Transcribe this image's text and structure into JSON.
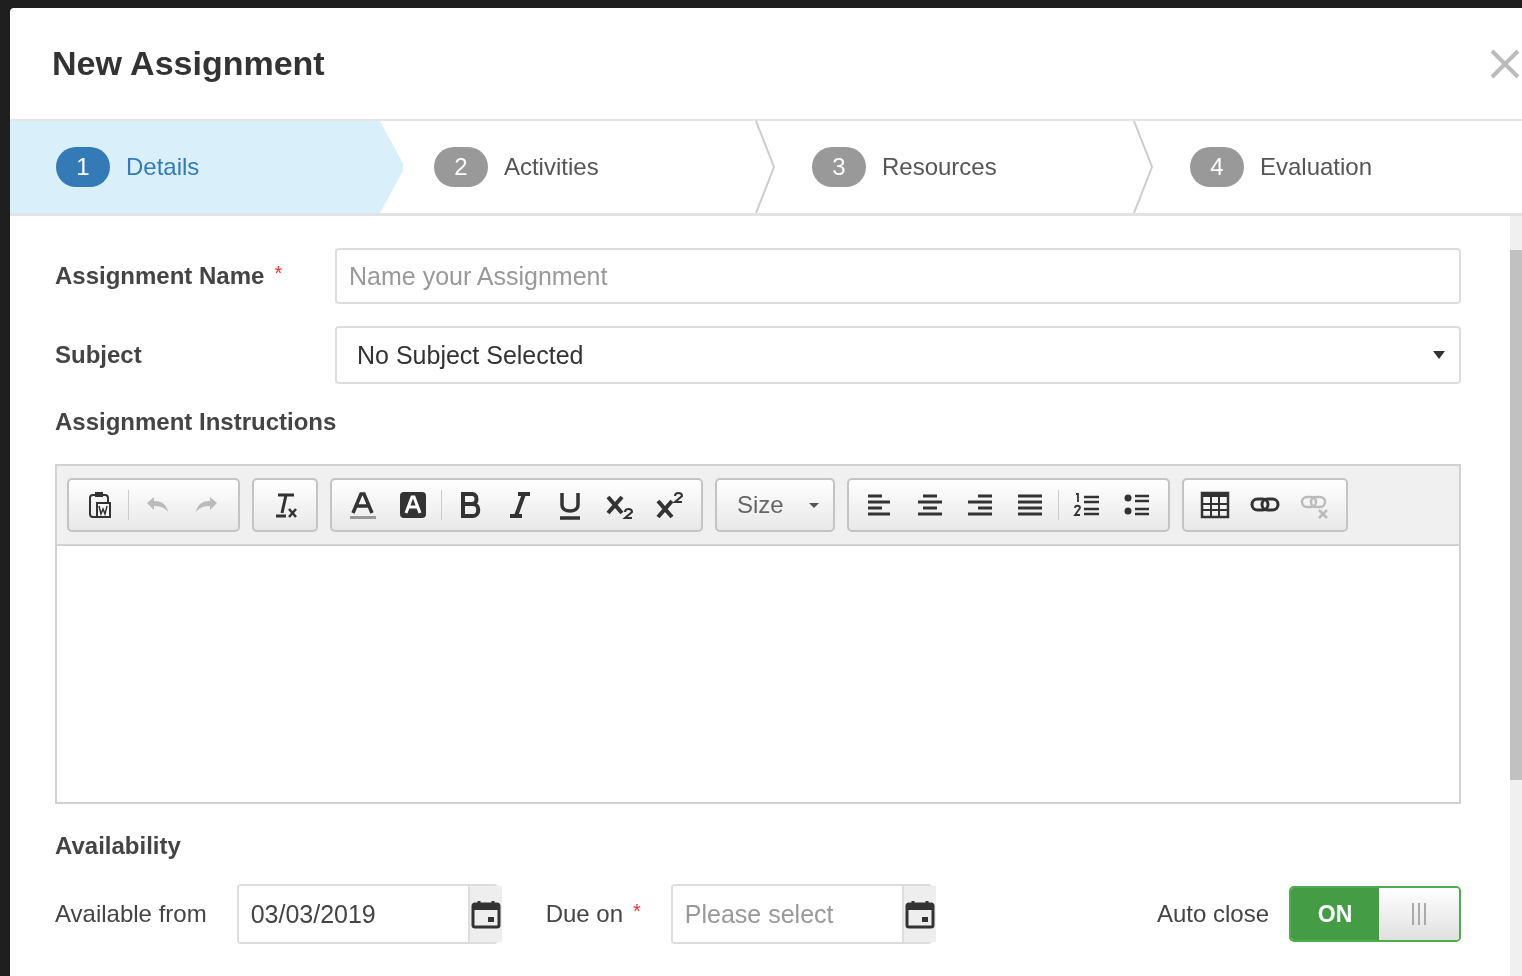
{
  "dialog": {
    "title": "New Assignment"
  },
  "steps": [
    {
      "number": "1",
      "label": "Details",
      "selected": true
    },
    {
      "number": "2",
      "label": "Activities",
      "selected": false
    },
    {
      "number": "3",
      "label": "Resources",
      "selected": false
    },
    {
      "number": "4",
      "label": "Evaluation",
      "selected": false
    }
  ],
  "assignment_name": {
    "label": "Assignment Name",
    "required_mark": "*",
    "placeholder": "Name your Assignment"
  },
  "subject": {
    "label": "Subject",
    "value": "No Subject Selected"
  },
  "instructions": {
    "label": "Assignment Instructions",
    "toolbar": [
      [
        {
          "kind": "paste",
          "disabled": false
        },
        {
          "kind": "sep"
        },
        {
          "kind": "undo",
          "disabled": true
        },
        {
          "kind": "redo",
          "disabled": true
        }
      ],
      [
        {
          "kind": "clear-format",
          "disabled": false
        }
      ],
      [
        {
          "kind": "text-color",
          "disabled": false
        },
        {
          "kind": "bg-color",
          "disabled": false
        },
        {
          "kind": "sep"
        },
        {
          "kind": "bold",
          "disabled": false
        },
        {
          "kind": "italic",
          "disabled": false
        },
        {
          "kind": "underline",
          "disabled": false
        },
        {
          "kind": "subscript",
          "disabled": false
        },
        {
          "kind": "superscript",
          "disabled": false
        }
      ],
      [
        {
          "kind": "size",
          "label": "Size",
          "disabled": false
        }
      ],
      [
        {
          "kind": "align-left",
          "disabled": false
        },
        {
          "kind": "align-center",
          "disabled": false
        },
        {
          "kind": "align-right",
          "disabled": false
        },
        {
          "kind": "justify",
          "disabled": false
        },
        {
          "kind": "sep"
        },
        {
          "kind": "numbered-list",
          "disabled": false
        },
        {
          "kind": "bullet-list",
          "disabled": false
        }
      ],
      [
        {
          "kind": "table",
          "disabled": false
        },
        {
          "kind": "link",
          "disabled": false
        },
        {
          "kind": "unlink",
          "disabled": true
        }
      ]
    ]
  },
  "availability": {
    "label": "Availability",
    "available_from": {
      "label": "Available from",
      "value": "03/03/2019"
    },
    "due_on": {
      "label": "Due on",
      "required_mark": "*",
      "placeholder": "Please select"
    },
    "auto_close": {
      "label": "Auto close",
      "on_label": "ON",
      "on": true
    }
  }
}
